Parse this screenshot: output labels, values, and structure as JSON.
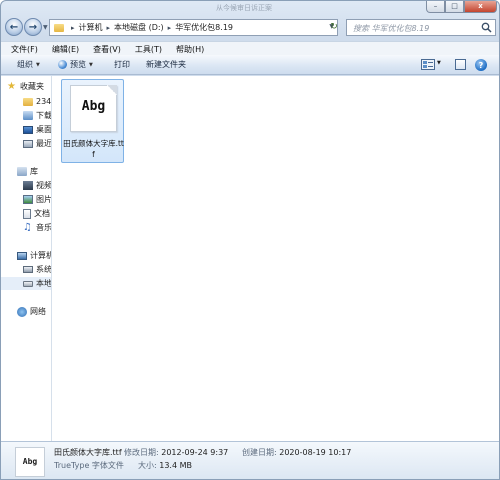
{
  "window": {
    "title": "从今候审日诉正案",
    "caption": {
      "minimize": "–",
      "maximize": "□",
      "close": "x"
    }
  },
  "address": {
    "segments": [
      "计算机",
      "本地磁盘 (D:)",
      "华军优化包8.19"
    ]
  },
  "search": {
    "placeholder": "搜索 华军优化包8.19"
  },
  "menu": [
    "文件(F)",
    "编辑(E)",
    "查看(V)",
    "工具(T)",
    "帮助(H)"
  ],
  "toolbar": {
    "organize": "组织",
    "preview": "预览",
    "print": "打印",
    "new_folder": "新建文件夹"
  },
  "nav": {
    "favorites": "收藏夹",
    "fav_items": [
      "234",
      "下载",
      "桌面",
      "最近"
    ],
    "libraries": "库",
    "lib_items": [
      "视频",
      "图片",
      "文档",
      "音乐"
    ],
    "computer": "计算机",
    "comp_items": [
      "系统",
      "本地"
    ],
    "network": "网络"
  },
  "file": {
    "thumb_text": "Abg",
    "name": "田氏颜体大字库.ttf"
  },
  "details": {
    "name": "田氏颜体大字库.ttf",
    "type": "TrueType 字体文件",
    "modified_label": "修改日期:",
    "modified_value": "2012-09-24 9:37",
    "created_label": "创建日期:",
    "created_value": "2020-08-19 10:17",
    "size_label": "大小:",
    "size_value": "13.4 MB",
    "thumb_text": "Abg"
  }
}
